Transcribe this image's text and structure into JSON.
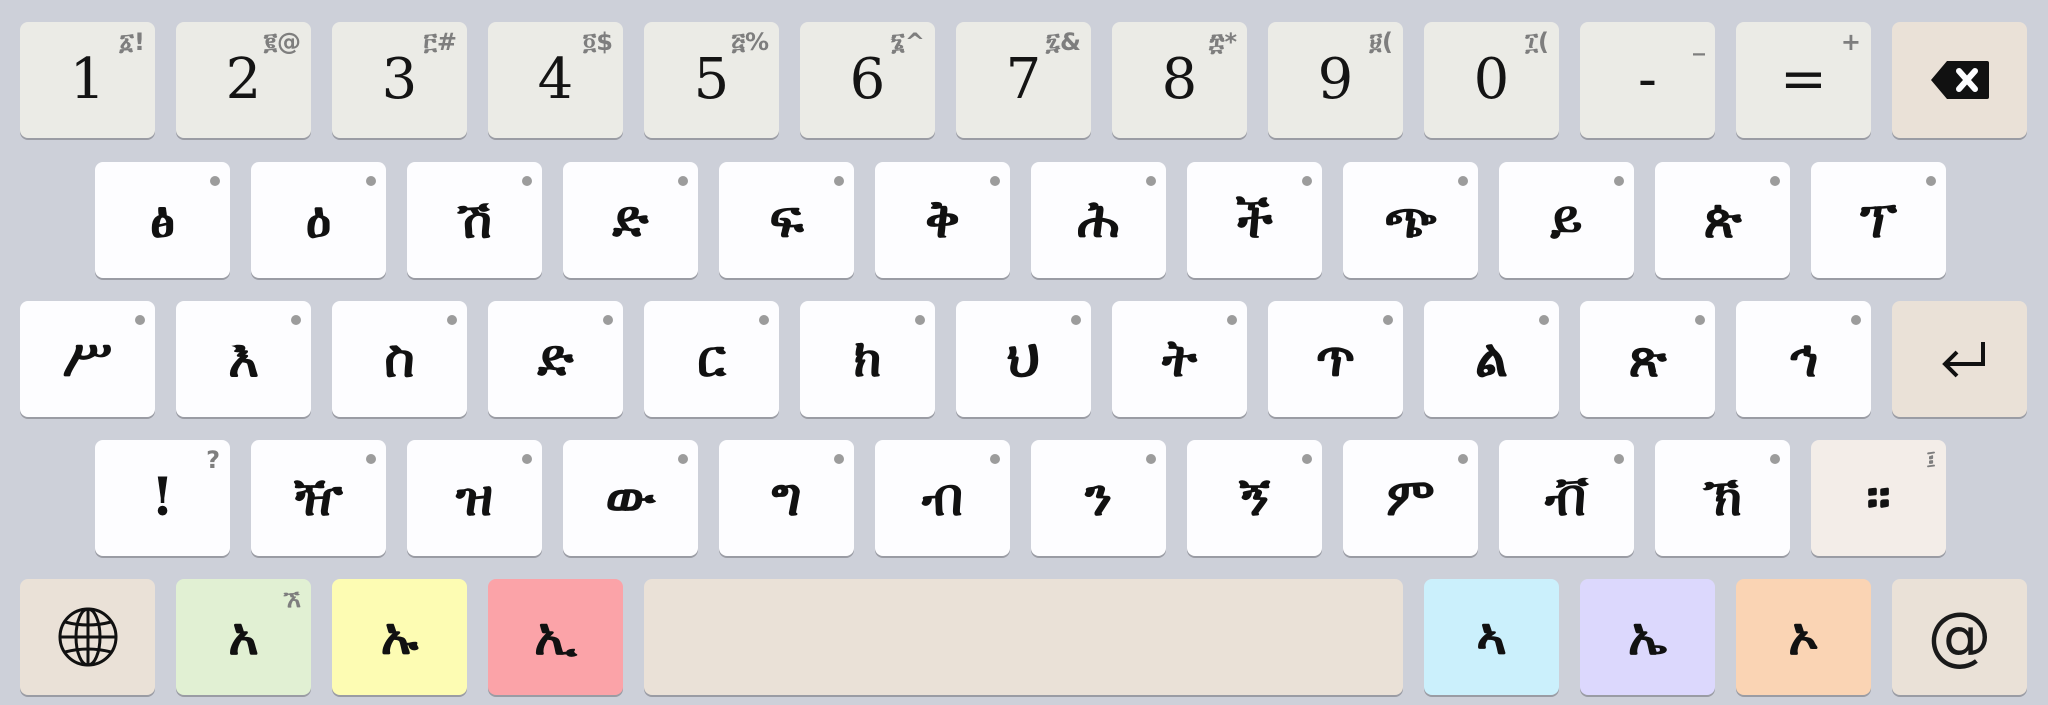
{
  "keyboard": {
    "rows": [
      {
        "keys": [
          {
            "label": "1",
            "sup": "፩!"
          },
          {
            "label": "2",
            "sup": "፪@"
          },
          {
            "label": "3",
            "sup": "፫#"
          },
          {
            "label": "4",
            "sup": "፬$"
          },
          {
            "label": "5",
            "sup": "፭%"
          },
          {
            "label": "6",
            "sup": "፮^"
          },
          {
            "label": "7",
            "sup": "፯&"
          },
          {
            "label": "8",
            "sup": "፰*"
          },
          {
            "label": "9",
            "sup": "፱("
          },
          {
            "label": "0",
            "sup": "፲("
          },
          {
            "label": "-",
            "sup": "_"
          },
          {
            "label": "=",
            "sup": "+"
          },
          {
            "icon": "backspace-icon"
          }
        ]
      },
      {
        "keys": [
          {
            "label": "ፅ"
          },
          {
            "label": "ዕ"
          },
          {
            "label": "ሽ"
          },
          {
            "label": "ድ"
          },
          {
            "label": "ፍ"
          },
          {
            "label": "ቅ"
          },
          {
            "label": "ሕ"
          },
          {
            "label": "ች"
          },
          {
            "label": "ጭ"
          },
          {
            "label": "ይ"
          },
          {
            "label": "ጵ"
          },
          {
            "label": "ፕ"
          }
        ]
      },
      {
        "keys": [
          {
            "label": "ሥ"
          },
          {
            "label": "እ"
          },
          {
            "label": "ስ"
          },
          {
            "label": "ድ"
          },
          {
            "label": "ር"
          },
          {
            "label": "ክ"
          },
          {
            "label": "ህ"
          },
          {
            "label": "ት"
          },
          {
            "label": "ጥ"
          },
          {
            "label": "ል"
          },
          {
            "label": "ጽ"
          },
          {
            "label": "ኅ"
          },
          {
            "icon": "enter-icon"
          }
        ]
      },
      {
        "keys": [
          {
            "label": "!",
            "sup": "?"
          },
          {
            "label": "ዥ"
          },
          {
            "label": "ዝ"
          },
          {
            "label": "ው"
          },
          {
            "label": "ግ"
          },
          {
            "label": "ብ"
          },
          {
            "label": "ን"
          },
          {
            "label": "ኝ"
          },
          {
            "label": "ም"
          },
          {
            "label": "ቭ"
          },
          {
            "label": "ኽ"
          },
          {
            "label": "።",
            "sup": "፤"
          }
        ]
      },
      {
        "keys": [
          {
            "icon": "globe-icon"
          },
          {
            "label": "አ",
            "sup": "ኧ"
          },
          {
            "label": "ኡ"
          },
          {
            "label": "ኢ"
          },
          {
            "label": ""
          },
          {
            "label": "ኣ"
          },
          {
            "label": "ኤ"
          },
          {
            "label": "ኦ"
          },
          {
            "label": "@"
          }
        ]
      }
    ],
    "colors": {
      "background": "#cdd0d9",
      "key": "#fdfdff",
      "number_key": "#ebebe6",
      "action_key": "#eae1d7",
      "vowel_a": "#e1f0d3",
      "vowel_u": "#fdfcb3",
      "vowel_i": "#fba3a8",
      "vowel_aa": "#cbf0fc",
      "vowel_e": "#dcd8fd",
      "vowel_o": "#fad4b4"
    }
  }
}
